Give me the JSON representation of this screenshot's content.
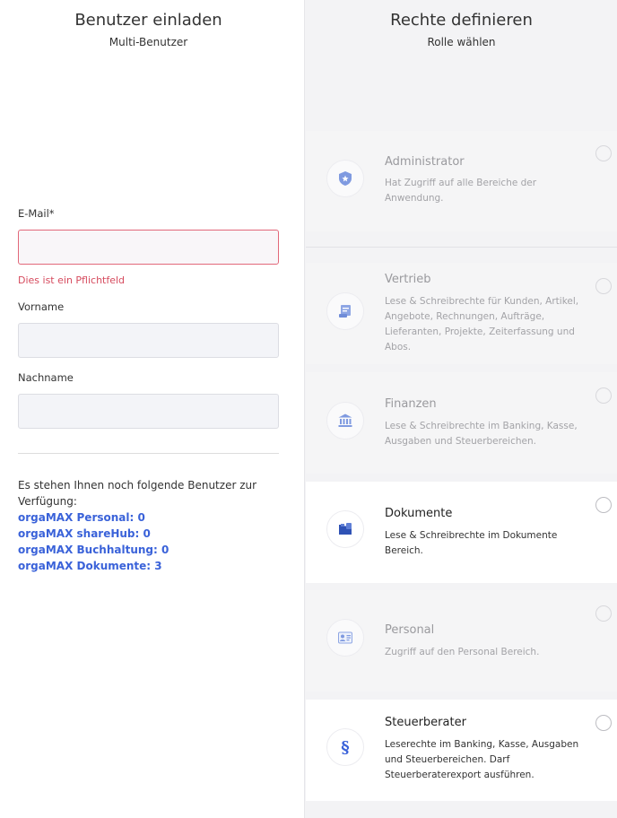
{
  "left": {
    "title": "Benutzer einladen",
    "subtitle": "Multi-Benutzer",
    "email_label": "E-Mail*",
    "email_value": "",
    "email_error": "Dies ist ein Pflichtfeld",
    "firstname_label": "Vorname",
    "firstname_value": "",
    "lastname_label": "Nachname",
    "lastname_value": "",
    "info_text": "Es stehen Ihnen noch folgende Benutzer zur Verfügung:",
    "quotas": [
      "orgaMAX Personal: 0",
      "orgaMAX shareHub: 0",
      "orgaMAX Buchhaltung: 0",
      "orgaMAX Dokumente: 3"
    ]
  },
  "right": {
    "title": "Rechte definieren",
    "subtitle": "Rolle wählen",
    "roles": [
      {
        "name": "Administrator",
        "desc": "Hat Zugriff auf alle Bereiche der Anwendung.",
        "icon": "shield-star-icon",
        "enabled": false
      },
      {
        "name": "Vertrieb",
        "desc": "Lese & Schreibrechte für Kunden, Artikel, Angebote, Rechnungen, Aufträge, Lieferanten, Projekte, Zeiterfassung und Abos.",
        "icon": "invoice-icon",
        "enabled": false
      },
      {
        "name": "Finanzen",
        "desc": "Lese & Schreibrechte im Banking, Kasse, Ausgaben und Steuerbereichen.",
        "icon": "bank-icon",
        "enabled": false
      },
      {
        "name": "Dokumente",
        "desc": "Lese & Schreibrechte im Dokumente Bereich.",
        "icon": "folder-icon",
        "enabled": true
      },
      {
        "name": "Personal",
        "desc": "Zugriff auf den Personal Bereich.",
        "icon": "id-card-icon",
        "enabled": false
      },
      {
        "name": "Steuerberater",
        "desc": "Leserechte im Banking, Kasse, Ausgaben und Steuerbereichen. Darf Steuerberaterexport ausführen.",
        "icon": "paragraph-icon",
        "enabled": true
      }
    ],
    "paragraph_symbol": "§"
  },
  "colors": {
    "accent": "#3a62d9",
    "error": "#d64b5e"
  }
}
